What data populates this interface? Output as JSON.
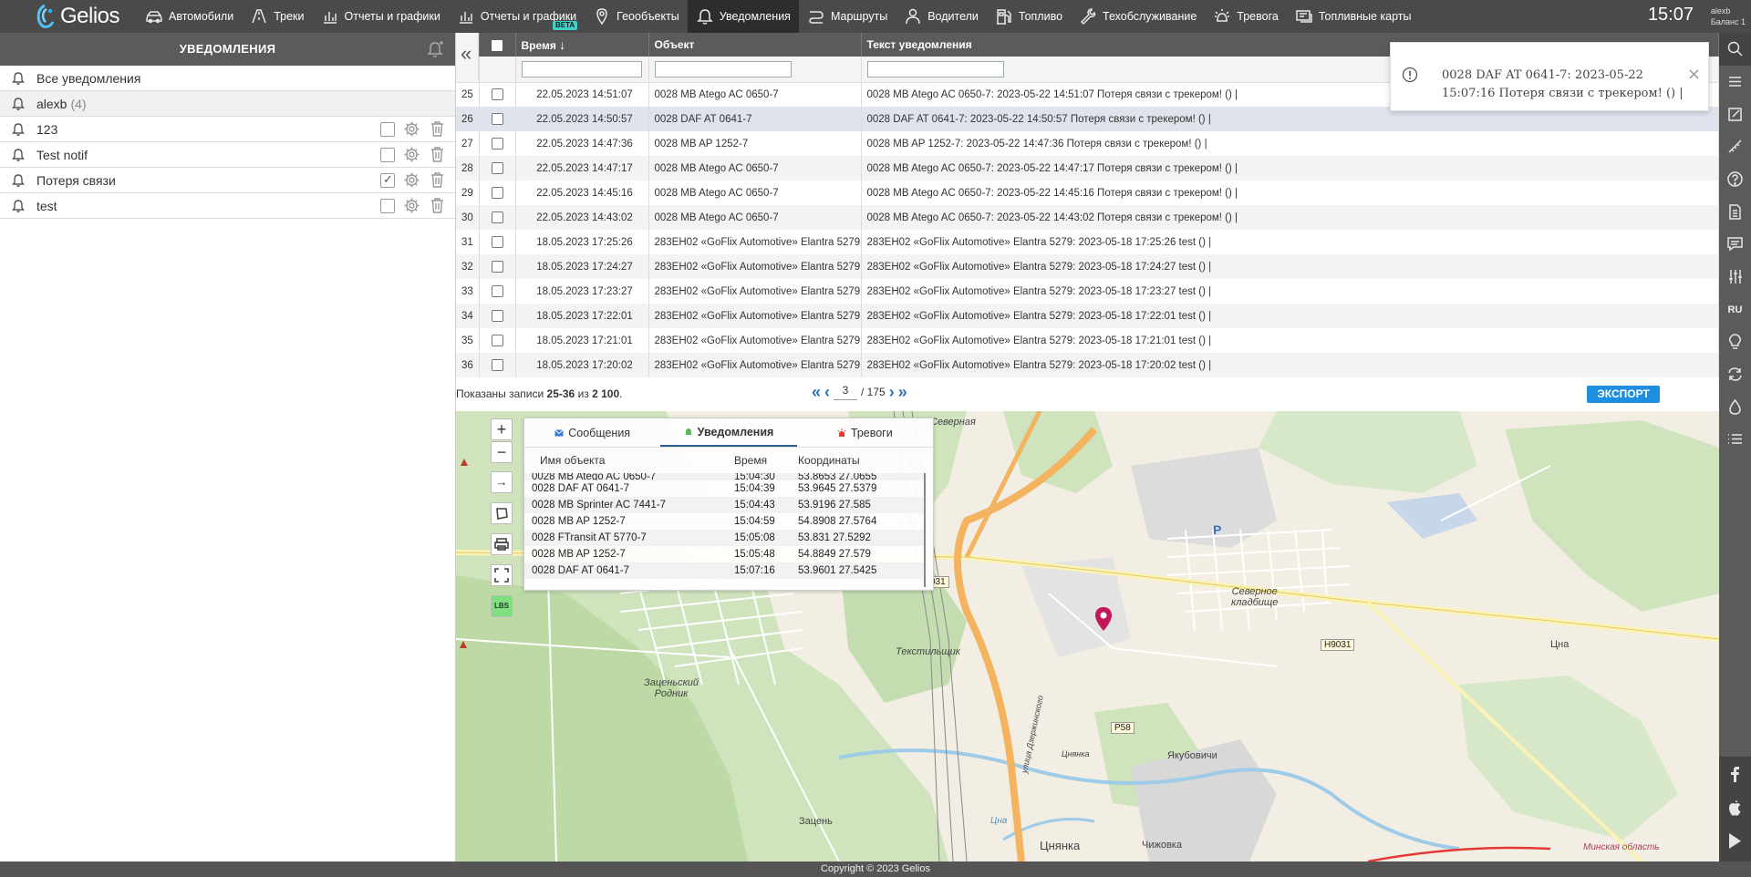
{
  "app": {
    "name": "Gelios",
    "clock": "15:07",
    "user_name": "alexb",
    "balance_label": "Баланс 1"
  },
  "nav": [
    {
      "label": "Автомобили",
      "icon": "car-icon"
    },
    {
      "label": "Треки",
      "icon": "track-icon"
    },
    {
      "label": "Отчеты и графики",
      "icon": "chart-icon"
    },
    {
      "label": "Отчеты и графики",
      "icon": "chart-icon",
      "badge": "BETA"
    },
    {
      "label": "Геообъекты",
      "icon": "geo-pin-icon"
    },
    {
      "label": "Уведомления",
      "icon": "bell-icon",
      "active": true
    },
    {
      "label": "Маршруты",
      "icon": "route-icon"
    },
    {
      "label": "Водители",
      "icon": "driver-icon"
    },
    {
      "label": "Топливо",
      "icon": "fuel-icon"
    },
    {
      "label": "Техобслуживание",
      "icon": "wrench-icon"
    },
    {
      "label": "Тревога",
      "icon": "alarm-icon"
    },
    {
      "label": "Топливные карты",
      "icon": "card-icon"
    }
  ],
  "left_panel": {
    "title": "УВЕДОМЛЕНИЯ",
    "items": [
      {
        "label": "Все уведомления",
        "count": "",
        "actions": false
      },
      {
        "label": "alexb",
        "count": "(4)",
        "actions": false,
        "selected": true
      },
      {
        "label": "123",
        "count": "",
        "actions": true,
        "checked": false
      },
      {
        "label": "Test notif",
        "count": "",
        "actions": true,
        "checked": false
      },
      {
        "label": "Потеря связи",
        "count": "",
        "actions": true,
        "checked": true
      },
      {
        "label": "test",
        "count": "",
        "actions": true,
        "checked": false
      }
    ]
  },
  "table": {
    "headers": {
      "time": "Время",
      "object": "Объект",
      "text": "Текст уведомления"
    },
    "rows": [
      {
        "n": "25",
        "time": "22.05.2023 14:51:07",
        "object": "0028 MB Atego AC 0650-7",
        "text": "0028 MB Atego AC 0650-7: 2023-05-22 14:51:07 Потеря связи с трекером! () |"
      },
      {
        "n": "26",
        "time": "22.05.2023 14:50:57",
        "object": "0028 DAF AT 0641-7",
        "text": "0028 DAF AT 0641-7: 2023-05-22 14:50:57 Потеря связи с трекером! () |",
        "highlight": true
      },
      {
        "n": "27",
        "time": "22.05.2023 14:47:36",
        "object": "0028 MB AP 1252-7",
        "text": "0028 MB AP 1252-7: 2023-05-22 14:47:36 Потеря связи с трекером! () |"
      },
      {
        "n": "28",
        "time": "22.05.2023 14:47:17",
        "object": "0028 MB Atego AC 0650-7",
        "text": "0028 MB Atego AC 0650-7: 2023-05-22 14:47:17 Потеря связи с трекером! () |"
      },
      {
        "n": "29",
        "time": "22.05.2023 14:45:16",
        "object": "0028 MB Atego AC 0650-7",
        "text": "0028 MB Atego AC 0650-7: 2023-05-22 14:45:16 Потеря связи с трекером! () |"
      },
      {
        "n": "30",
        "time": "22.05.2023 14:43:02",
        "object": "0028 MB Atego AC 0650-7",
        "text": "0028 MB Atego AC 0650-7: 2023-05-22 14:43:02 Потеря связи с трекером! () |"
      },
      {
        "n": "31",
        "time": "18.05.2023 17:25:26",
        "object": "283EH02 «GoFlix Automotive» Elantra 5279",
        "text": "283EH02 «GoFlix Automotive» Elantra 5279: 2023-05-18 17:25:26 test () |"
      },
      {
        "n": "32",
        "time": "18.05.2023 17:24:27",
        "object": "283EH02 «GoFlix Automotive» Elantra 5279",
        "text": "283EH02 «GoFlix Automotive» Elantra 5279: 2023-05-18 17:24:27 test () |"
      },
      {
        "n": "33",
        "time": "18.05.2023 17:23:27",
        "object": "283EH02 «GoFlix Automotive» Elantra 5279",
        "text": "283EH02 «GoFlix Automotive» Elantra 5279: 2023-05-18 17:23:27 test () |"
      },
      {
        "n": "34",
        "time": "18.05.2023 17:22:01",
        "object": "283EH02 «GoFlix Automotive» Elantra 5279",
        "text": "283EH02 «GoFlix Automotive» Elantra 5279: 2023-05-18 17:22:01 test () |"
      },
      {
        "n": "35",
        "time": "18.05.2023 17:21:01",
        "object": "283EH02 «GoFlix Automotive» Elantra 5279",
        "text": "283EH02 «GoFlix Automotive» Elantra 5279: 2023-05-18 17:21:01 test () |"
      },
      {
        "n": "36",
        "time": "18.05.2023 17:20:02",
        "object": "283EH02 «GoFlix Automotive» Elantra 5279",
        "text": "283EH02 «GoFlix Automotive» Elantra 5279: 2023-05-18 17:20:02 test () |"
      }
    ]
  },
  "pagination": {
    "info_prefix": "Показаны записи ",
    "range": "25-36",
    "of": " из ",
    "total": "2 100",
    "suffix": ".",
    "current_page": "3",
    "total_pages": "/ 175",
    "export_label": "ЭКСПОРТ"
  },
  "toast": {
    "message": "0028 DAF AT 0641-7: 2023-05-22 15:07:16 Потеря связи с трекером! () |",
    "close": "×"
  },
  "map_popup": {
    "tabs": [
      {
        "label": "Сообщения",
        "icon": "message-icon"
      },
      {
        "label": "Уведомления",
        "icon": "bell-icon",
        "active": true
      },
      {
        "label": "Тревоги",
        "icon": "alarm-icon"
      }
    ],
    "headers": {
      "name": "Имя объекта",
      "time": "Время",
      "coords": "Координаты"
    },
    "partial_row": {
      "name": "0028 MB Atego AC 0650-7",
      "time": "15:04:30",
      "coords": "53.8653 27.0655"
    },
    "rows": [
      {
        "name": "0028 DAF AT 0641-7",
        "time": "15:04:39",
        "coords": "53.9645 27.5379"
      },
      {
        "name": "0028 MB Sprinter AC 7441-7",
        "time": "15:04:43",
        "coords": "53.9196 27.585"
      },
      {
        "name": "0028 MB AP 1252-7",
        "time": "15:04:59",
        "coords": "54.8908 27.5764"
      },
      {
        "name": "0028 FTransit AT 5770-7",
        "time": "15:05:08",
        "coords": "53.831 27.5292"
      },
      {
        "name": "0028 MB AP 1252-7",
        "time": "15:05:48",
        "coords": "54.8849 27.579"
      },
      {
        "name": "0028 DAF AT 0641-7",
        "time": "15:07:16",
        "coords": "53.9601 27.5425"
      }
    ]
  },
  "map": {
    "labels": {
      "severnaya": "Северная",
      "cemetery": "Северное\nкладбище",
      "tekstilshchik": "Текстильщик",
      "zatsensky": "Заценьский\nРодник",
      "zatsen": "Зацень",
      "tsnyanka_small": "Цнянка",
      "dzerzhinskogo": "улица Дзержинского",
      "yakubovichi": "Якубовичи",
      "tsnyanka": "Цнянка",
      "chizhovka": "Чижовка",
      "tsna": "Цна",
      "tsna2": "Цна",
      "minsk_region": "Минская область",
      "parking": "P"
    },
    "roads": {
      "h9031_a": "031",
      "h9031_b": "H9031",
      "p58": "P58"
    },
    "controls": {
      "zoom_in": "+",
      "zoom_out": "−",
      "arrow": "→",
      "lbs": "LBS"
    }
  },
  "right_bar": {
    "lang": "RU"
  },
  "footer": {
    "copyright": "Copyright © 2023 Gelios"
  },
  "colors": {
    "accent": "#1e8ee0",
    "header_bg": "#4a4a4a",
    "panel_header": "#5b5b5b",
    "marker": "#c2185b"
  }
}
